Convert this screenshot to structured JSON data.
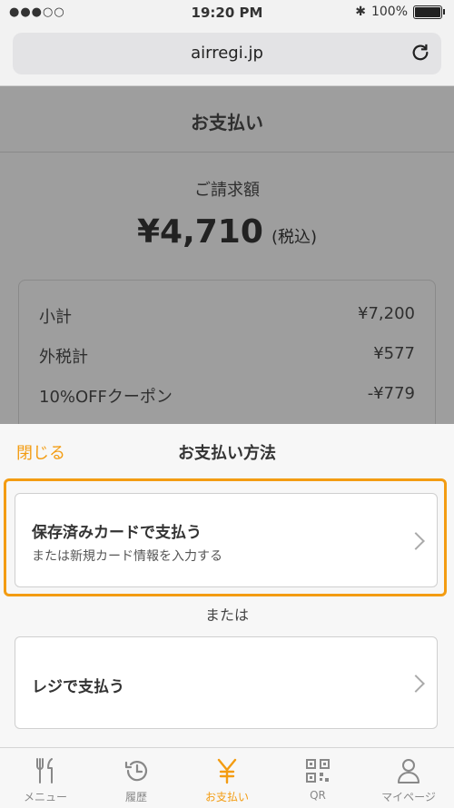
{
  "status_bar": {
    "signal": "●●●○○",
    "time": "19:20 PM",
    "bluetooth": "✱",
    "battery": "100%"
  },
  "browser": {
    "url": "airregi.jp"
  },
  "page": {
    "title": "お支払い",
    "amount_label": "ご請求額",
    "amount_value": "¥4,710",
    "amount_tax_note": "(税込)",
    "breakdown": [
      {
        "label": "小計",
        "value": "¥7,200"
      },
      {
        "label": "外税計",
        "value": "¥577"
      },
      {
        "label": "10%OFFクーポン",
        "value": "-¥779"
      }
    ]
  },
  "sheet": {
    "close_label": "閉じる",
    "title": "お支払い方法",
    "saved_card": {
      "title": "保存済みカードで支払う",
      "subtitle": "または新規カード情報を入力する"
    },
    "or_label": "または",
    "register": {
      "title": "レジで支払う"
    },
    "accent_color": "#f39c12"
  },
  "tabs": [
    {
      "label": "メニュー",
      "icon": "fork-knife-icon"
    },
    {
      "label": "履歴",
      "icon": "history-icon"
    },
    {
      "label": "お支払い",
      "icon": "yen-icon",
      "active": true
    },
    {
      "label": "QR",
      "icon": "qr-code-icon"
    },
    {
      "label": "マイページ",
      "icon": "person-icon"
    }
  ]
}
